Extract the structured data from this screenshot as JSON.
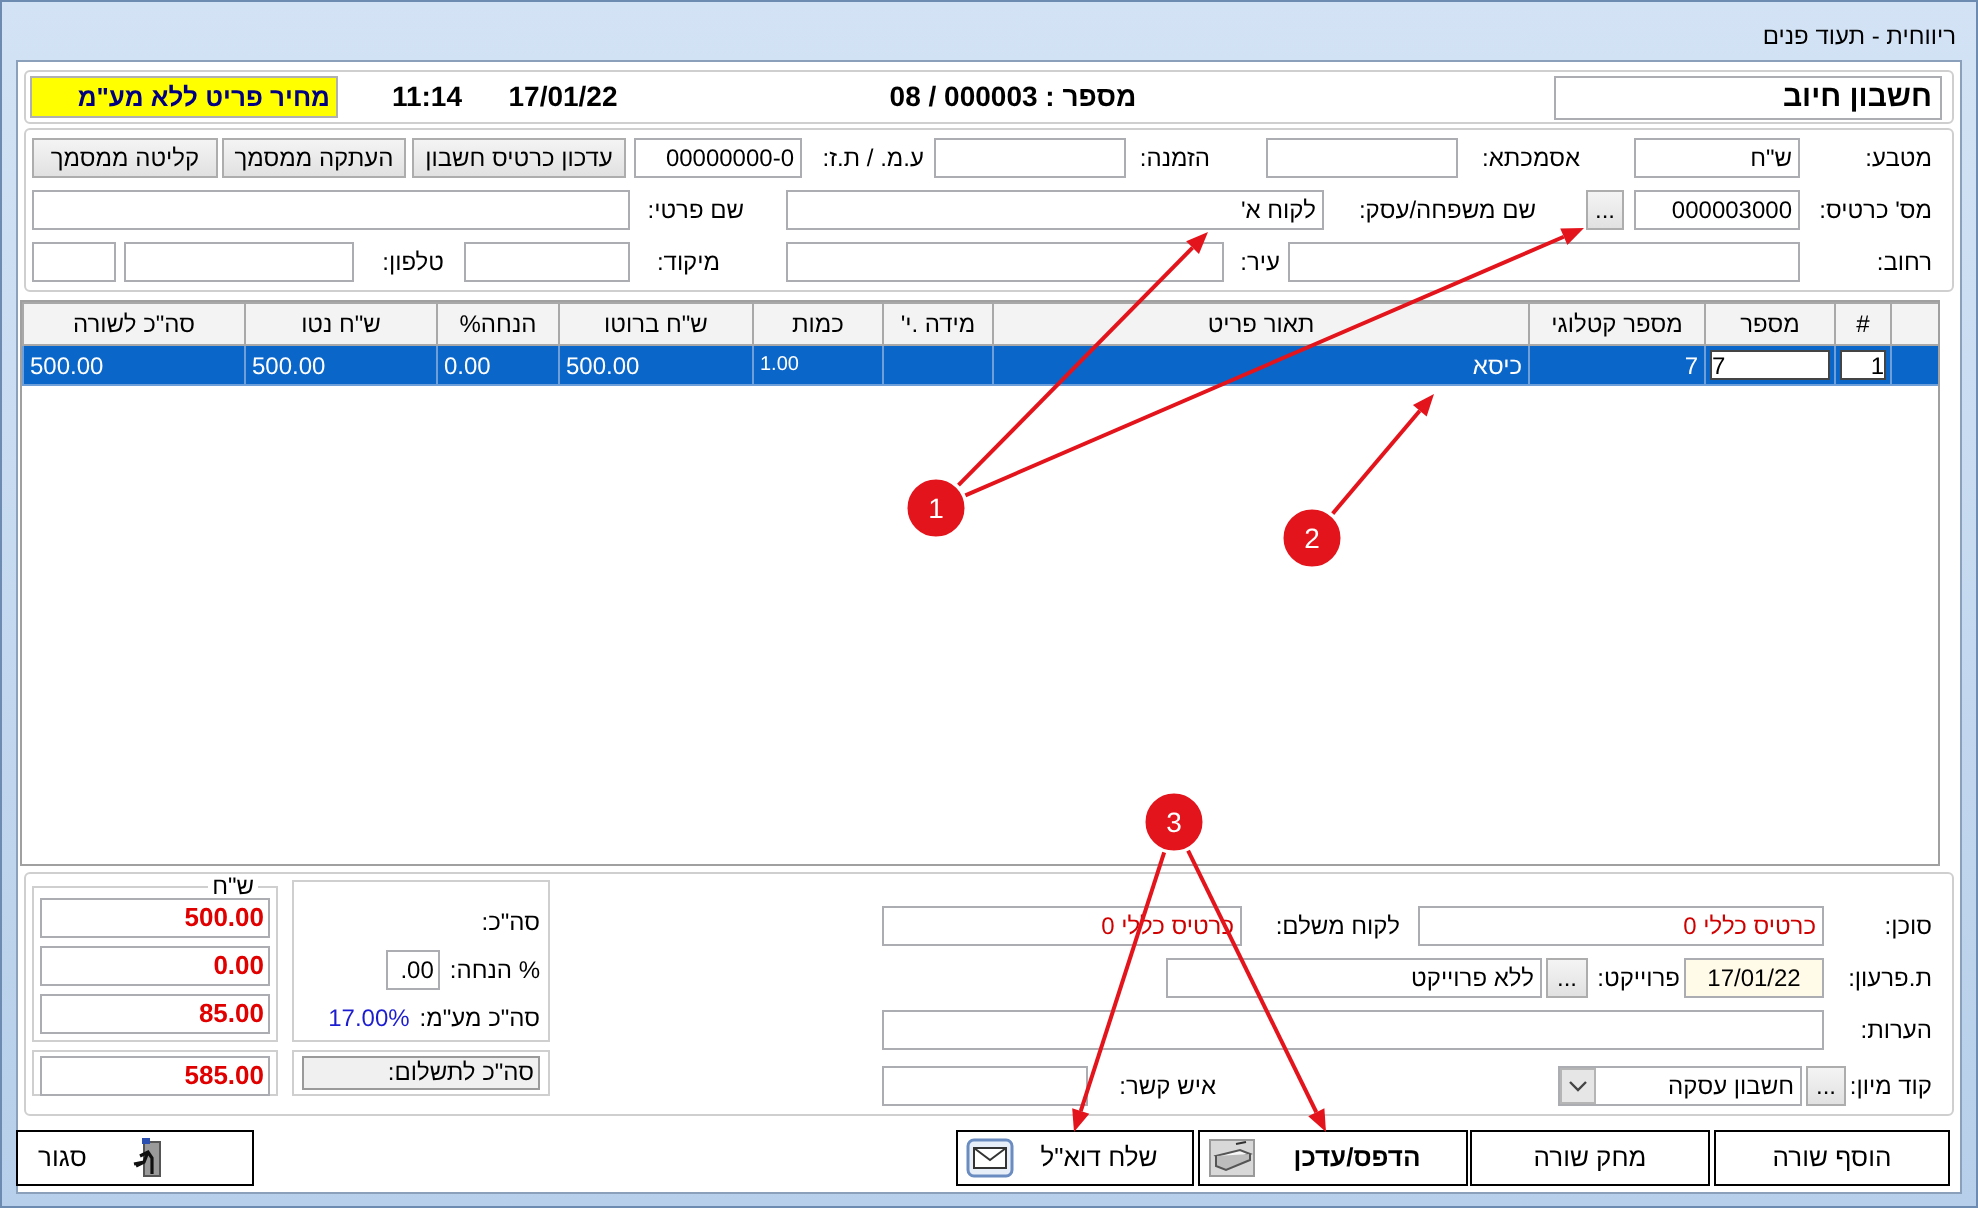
{
  "window": {
    "title": "ריווחית - תעוד פנים"
  },
  "header": {
    "document_type": "חשבון חיוב",
    "number": "מספר : 000003 / 08",
    "date": "17/01/22",
    "time": "11:14",
    "price_note": "מחיר פריט ללא מע\"מ"
  },
  "customer_form": {
    "fields": [
      {
        "kind": "label",
        "text": "מטבע:"
      },
      {
        "kind": "input",
        "value": "ש\"ח"
      },
      {
        "kind": "label",
        "text": "אסמכתא:"
      },
      {
        "kind": "input"
      },
      {
        "kind": "label",
        "text": "הזמנה:"
      },
      {
        "kind": "input"
      },
      {
        "kind": "label",
        "text": "ע.מ. / ת.ז:"
      },
      {
        "kind": "input",
        "value": "00000000-0"
      },
      {
        "kind": "button",
        "text": "עדכון כרטיס חשבון"
      },
      {
        "kind": "button",
        "text": "העתקה ממסמך"
      },
      {
        "kind": "button",
        "text": "קליטה ממסמך"
      },
      {
        "kind": "label",
        "text": "מס' כרטיס:"
      },
      {
        "kind": "input",
        "value": "000003000"
      },
      {
        "kind": "button",
        "text": "..."
      },
      {
        "kind": "label",
        "text": "שם משפחה/עסק:"
      },
      {
        "kind": "input",
        "value": "לקוח א'"
      },
      {
        "kind": "label",
        "text": "שם פרטי:"
      },
      {
        "kind": "input"
      },
      {
        "kind": "label",
        "text": "רחוב:"
      },
      {
        "kind": "input"
      },
      {
        "kind": "label",
        "text": "עיר:"
      },
      {
        "kind": "input"
      },
      {
        "kind": "label",
        "text": "מיקוד:"
      },
      {
        "kind": "input"
      },
      {
        "kind": "label",
        "text": "טלפון:"
      },
      {
        "kind": "input"
      },
      {
        "kind": "input"
      }
    ]
  },
  "items_table": {
    "columns": [
      "#",
      "מספר",
      "מספר קטלוגי",
      "תאור פריט",
      "מידה .י'",
      "כמות",
      "ש\"ח ברוטו",
      "הנחה%",
      "ש\"ח נטו",
      "סה\"כ לשורה"
    ],
    "rows": [
      {
        "selected": true,
        "cells": [
          {
            "text": "1",
            "boxed": true
          },
          {
            "text": "7",
            "boxed": true
          },
          {
            "text": "7",
            "boxed": false
          },
          {
            "text": "כיסא",
            "boxed": false
          },
          {
            "boxed": false
          },
          {
            "text": "1.00",
            "boxed": false
          },
          {
            "text": "500.00",
            "boxed": false
          },
          {
            "text": "0.00",
            "boxed": false
          },
          {
            "text": "500.00",
            "boxed": false
          },
          {
            "text": "500.00",
            "boxed": false
          }
        ]
      }
    ]
  },
  "footer_form": {
    "fields": [
      {
        "kind": "label",
        "text": "סוכן:"
      },
      {
        "kind": "alert-input",
        "value": "כרטיס כללי 0"
      },
      {
        "kind": "label",
        "text": "לקוח משלם:"
      },
      {
        "kind": "alert-input",
        "value": "כרטיס כללי 0"
      },
      {
        "kind": "label",
        "text": "ת.פרעון:"
      },
      {
        "kind": "date-input",
        "value": "17/01/22"
      },
      {
        "kind": "label",
        "text": "פרוייקט:"
      },
      {
        "kind": "button",
        "text": "..."
      },
      {
        "kind": "input",
        "value": "ללא פרוייקט"
      },
      {
        "kind": "label",
        "text": "הערות:"
      },
      {
        "kind": "input"
      },
      {
        "kind": "label",
        "text": "קוד מיון:"
      },
      {
        "kind": "button",
        "text": "..."
      },
      {
        "kind": "select",
        "value": "חשבון עסקה"
      },
      {
        "kind": "label",
        "text": "איש קשר:"
      },
      {
        "kind": "input"
      }
    ]
  },
  "totals": {
    "currency": "ש\"ח",
    "lines": [
      {
        "label": "סה\"כ:",
        "value": "500.00"
      },
      {
        "label": "% הנחה:",
        "input": ".00",
        "value": "0.00"
      },
      {
        "label": "סה\"כ מע\"מ:",
        "rate": "17.00%",
        "value": "85.00"
      }
    ],
    "payable": {
      "label": "סה\"כ לתשלום:",
      "value": "585.00"
    }
  },
  "actions": [
    {
      "label": "הוסף שורה",
      "kind": "plain",
      "default": false
    },
    {
      "label": "מחק שורה",
      "kind": "plain",
      "default": false
    },
    {
      "label": "הדפס/עדכן",
      "kind": "print",
      "default": true
    },
    {
      "label": "שלח דוא\"ל",
      "kind": "email",
      "default": false
    },
    {
      "label": "סגור",
      "kind": "close",
      "default": false
    }
  ],
  "annotations": [
    {
      "label": "1"
    },
    {
      "label": "2"
    },
    {
      "label": "3"
    }
  ]
}
